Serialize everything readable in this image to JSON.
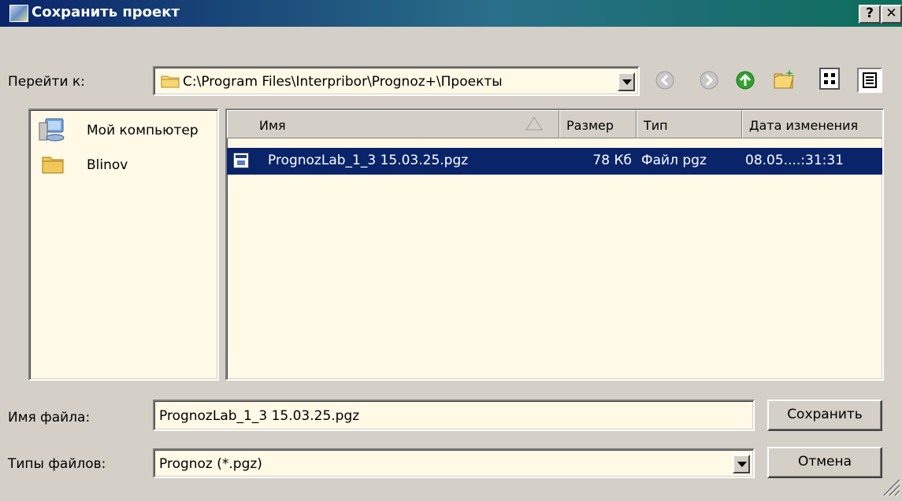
{
  "window": {
    "title": "Сохранить проект",
    "help_label": "?",
    "close_label": "✕"
  },
  "lookin": {
    "label": "Перейти к:",
    "path": "C:\\Program Files\\Interpribor\\Prognoz+\\Проекты",
    "toolbar_icons": [
      "back-icon",
      "forward-icon",
      "up-folder-icon",
      "new-folder-icon",
      "view-icons-icon",
      "view-details-icon"
    ]
  },
  "places": [
    {
      "label": "Мой компьютер",
      "icon": "my-computer-icon"
    },
    {
      "label": "Blinov",
      "icon": "folder-icon"
    }
  ],
  "file_list": {
    "columns": [
      "Имя",
      "Размер",
      "Тип",
      "Дата изменения"
    ],
    "sort_column": "Имя",
    "rows": [
      {
        "name": "PrognozLab_1_3 15.03.25.pgz",
        "size": "78 Кб",
        "type": "Файл pgz",
        "modified": "08.05....:31:31",
        "selected": true
      }
    ]
  },
  "filename": {
    "label": "Имя файла:",
    "value": "PrognozLab_1_3 15.03.25.pgz"
  },
  "filetype": {
    "label": "Типы файлов:",
    "value": "Prognoz (*.pgz)"
  },
  "buttons": {
    "save": "Сохранить",
    "cancel": "Отмена"
  },
  "colors": {
    "selection": "#0a246a",
    "field": "#fff9e6",
    "face": "#d4d0c8",
    "up_icon": "#2fa22f"
  }
}
